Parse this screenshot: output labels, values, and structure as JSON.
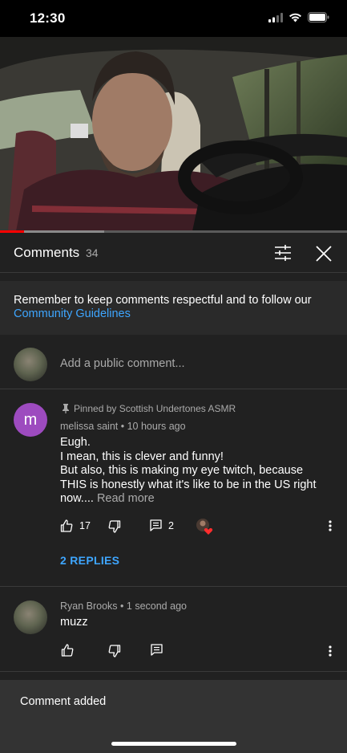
{
  "status_bar": {
    "time": "12:30"
  },
  "player": {
    "progress": 0.07,
    "buffered": 0.3
  },
  "header": {
    "title": "Comments",
    "count": "34"
  },
  "guidelines": {
    "text": "Remember to keep comments respectful and to follow our",
    "link": "Community Guidelines"
  },
  "add_comment": {
    "placeholder": "Add a public comment..."
  },
  "comments": [
    {
      "avatar_letter": "m",
      "pinned_label": "Pinned by Scottish Undertones ASMR",
      "author": "melissa saint",
      "time": "10 hours ago",
      "text": "Eugh.\n I mean, this is clever and funny!\nBut also, this is making my eye twitch, because THIS is honestly what it's like to be in the US right now....",
      "read_more": "Read more",
      "likes": "17",
      "reply_count": "2",
      "replies_link": "2 REPLIES"
    },
    {
      "author": "Ryan Brooks",
      "time": "1 second ago",
      "text": "muzz"
    }
  ],
  "snackbar": {
    "text": "Comment added"
  },
  "colors": {
    "accent_link": "#3ea6ff",
    "progress": "#ff0000",
    "avatar_m": "#9d4bbf"
  }
}
